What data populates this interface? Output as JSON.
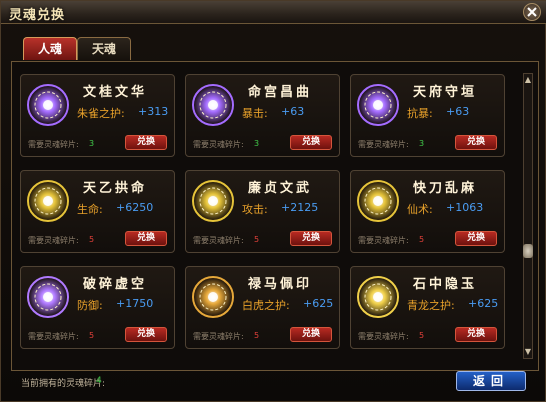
{
  "window": {
    "title": "灵魂兑换"
  },
  "tabs": [
    {
      "label": "人魂",
      "active": true
    },
    {
      "label": "天魂",
      "active": false
    }
  ],
  "cards": [
    {
      "name": "文桂文华",
      "stat_label": "朱雀之护:",
      "stat_value": "+313",
      "req_label": "需要灵魂碎片:",
      "req_value": "3",
      "req_color": "#41c94a",
      "button": "兑换",
      "gem_color": "#a46cff",
      "gem_icon": "purple-soul-gem-icon"
    },
    {
      "name": "命宫昌曲",
      "stat_label": "暴击:",
      "stat_value": "+63",
      "req_label": "需要灵魂碎片:",
      "req_value": "3",
      "req_color": "#41c94a",
      "button": "兑换",
      "gem_color": "#a46cff",
      "gem_icon": "purple-soul-gem-icon"
    },
    {
      "name": "天府守垣",
      "stat_label": "抗暴:",
      "stat_value": "+63",
      "req_label": "需要灵魂碎片:",
      "req_value": "3",
      "req_color": "#41c94a",
      "button": "兑换",
      "gem_color": "#a46cff",
      "gem_icon": "purple-soul-gem-icon"
    },
    {
      "name": "天乙拱命",
      "stat_label": "生命:",
      "stat_value": "+6250",
      "req_label": "需要灵魂碎片:",
      "req_value": "5",
      "req_color": "#e0403a",
      "button": "兑换",
      "gem_color": "#e6c43a",
      "gem_icon": "gold-soul-gem-icon"
    },
    {
      "name": "廉贞文武",
      "stat_label": "攻击:",
      "stat_value": "+2125",
      "req_label": "需要灵魂碎片:",
      "req_value": "5",
      "req_color": "#e0403a",
      "button": "兑换",
      "gem_color": "#e6c43a",
      "gem_icon": "gold-soul-gem-icon"
    },
    {
      "name": "快刀乱麻",
      "stat_label": "仙术:",
      "stat_value": "+1063",
      "req_label": "需要灵魂碎片:",
      "req_value": "5",
      "req_color": "#e0403a",
      "button": "兑换",
      "gem_color": "#e6c43a",
      "gem_icon": "gold-soul-gem-icon"
    },
    {
      "name": "破碎虚空",
      "stat_label": "防御:",
      "stat_value": "+1750",
      "req_label": "需要灵魂碎片:",
      "req_value": "5",
      "req_color": "#e0403a",
      "button": "兑换",
      "gem_color": "#b07aff",
      "gem_icon": "violet-gold-soul-gem-icon"
    },
    {
      "name": "禄马佩印",
      "stat_label": "白虎之护:",
      "stat_value": "+625",
      "req_label": "需要灵魂碎片:",
      "req_value": "5",
      "req_color": "#e0403a",
      "button": "兑换",
      "gem_color": "#e6a83a",
      "gem_icon": "amber-soul-gem-icon"
    },
    {
      "name": "石中隐玉",
      "stat_label": "青龙之护:",
      "stat_value": "+625",
      "req_label": "需要灵魂碎片:",
      "req_value": "5",
      "req_color": "#e0403a",
      "button": "兑换",
      "gem_color": "#f0d04a",
      "gem_icon": "yellow-soul-gem-icon"
    }
  ],
  "footer": {
    "owned_label": "当前拥有的灵魂碎片:",
    "owned_value": "4",
    "return_button": "返回"
  },
  "icons": {
    "close": "close-icon",
    "scroll_up": "scroll-up-arrow-icon",
    "scroll_down": "scroll-down-arrow-icon"
  }
}
